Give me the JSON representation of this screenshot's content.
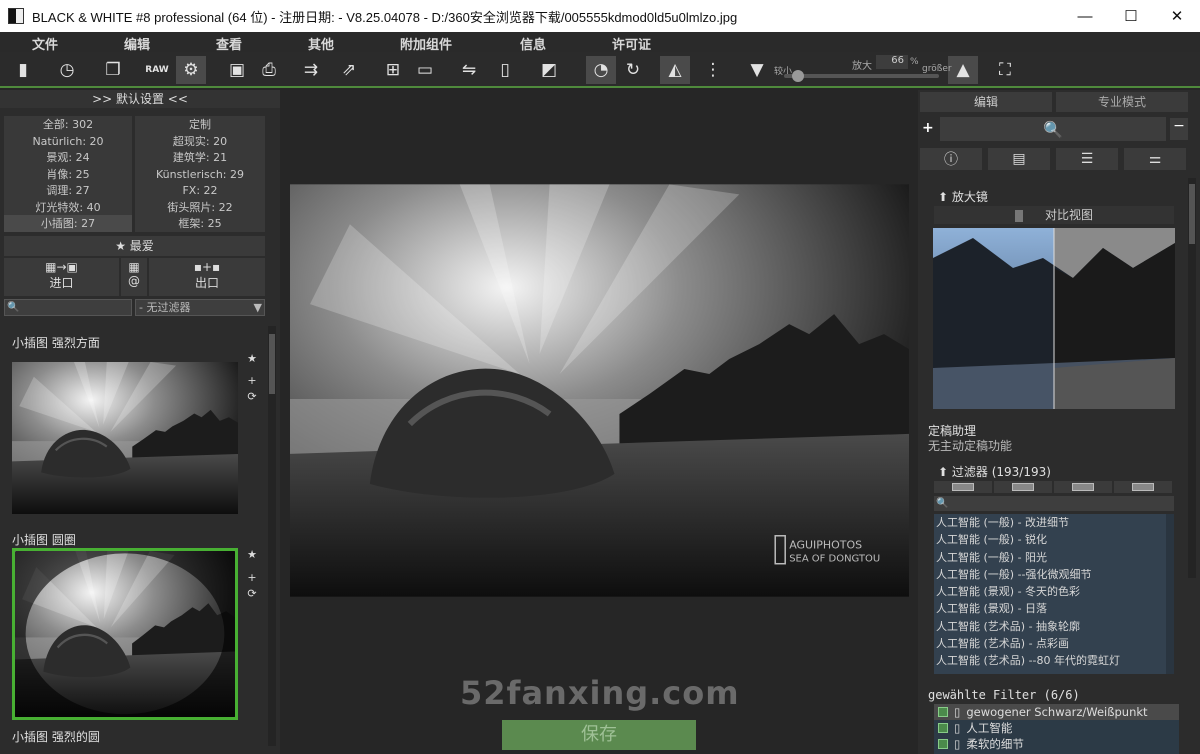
{
  "window": {
    "title": "BLACK & WHITE #8 professional (64 位) - 注册日期:   - V8.25.04078 - D:/360安全浏览器下载/005555kdmod0ld5u0lmlzo.jpg"
  },
  "menu": [
    "文件",
    "编辑",
    "查看",
    "其他",
    "附加组件",
    "信息",
    "许可证"
  ],
  "zoom": {
    "min_label": "较小",
    "label": "放大",
    "value": "66",
    "unit": "%",
    "max_label": "größer",
    "level_percent": 66
  },
  "left_panel": {
    "header": ">> 默认设置 <<",
    "categories": [
      [
        "全部: 302",
        "定制"
      ],
      [
        "Natürlich: 20",
        "超现实: 20"
      ],
      [
        "景观: 24",
        "建筑学: 21"
      ],
      [
        "肖像: 25",
        "Künstlerisch: 29"
      ],
      [
        "调理: 27",
        "FX: 22"
      ],
      [
        "灯光特效: 40",
        "街头照片: 22"
      ],
      [
        "小插图: 27",
        "框架: 25"
      ]
    ],
    "favorite": "★ 最爱",
    "import": "进口",
    "at": "@",
    "export": "出口",
    "filter_placeholder": "- 无过滤器",
    "thumbs": [
      "小插图 强烈方面",
      "小插图 圆圈",
      "小插图 强烈的圆"
    ]
  },
  "center": {
    "watermark": "52fanxing.com",
    "save": "保存",
    "photo_credit": [
      "AGUIPHOTOS",
      "SEA OF DONGTOU"
    ]
  },
  "right_panel": {
    "tabs": [
      "编辑",
      "专业模式"
    ],
    "magnifier": "放大镜",
    "compare": "对比视图",
    "assistant_title": "定稿助理",
    "assistant_text": "无主动定稿功能",
    "filters_title": "过滤器 (193/193)",
    "filters": [
      "人工智能 (一般) - 改进细节",
      "人工智能 (一般) - 锐化",
      "人工智能 (一般) - 阳光",
      "人工智能 (一般) --强化微观细节",
      "人工智能 (景观) - 冬天的色彩",
      "人工智能 (景观) - 日落",
      "人工智能 (艺术品) - 抽象轮廓",
      "人工智能 (艺术品) - 点彩画",
      "人工智能 (艺术品) --80 年代的霓虹灯"
    ],
    "selected_title": "gewählte Filter (6/6)",
    "selected": [
      "gewogener Schwarz/Weißpunkt",
      "人工智能",
      "柔软的细节"
    ]
  }
}
